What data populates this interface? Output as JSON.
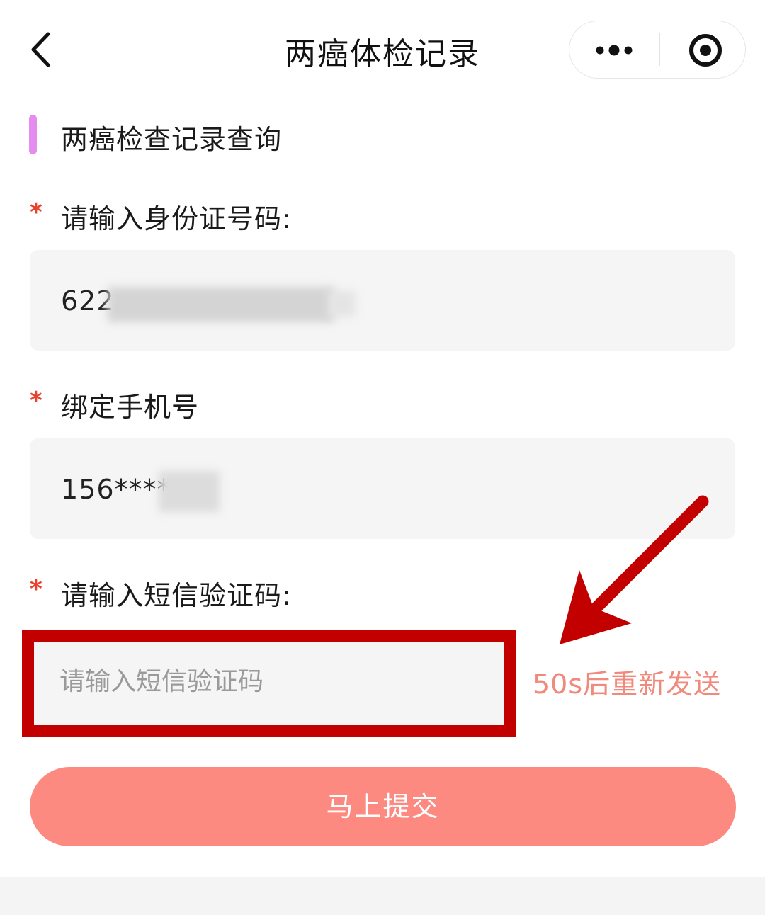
{
  "nav": {
    "title": "两癌体检记录",
    "back_icon": "chevron-left-icon",
    "more_icon": "more-dots-icon",
    "close_icon": "target-circle-icon"
  },
  "section": {
    "title": "两癌检查记录查询",
    "accent_color": "#e58cf1"
  },
  "form": {
    "id_field": {
      "required_mark": "*",
      "label": "请输入身份证号码:",
      "value": "622"
    },
    "phone_field": {
      "required_mark": "*",
      "label": "绑定手机号",
      "value": "156****"
    },
    "sms_field": {
      "required_mark": "*",
      "label": "请输入短信验证码:",
      "placeholder": "请输入短信验证码",
      "value": ""
    },
    "resend_label": "50s后重新发送",
    "submit_label": "马上提交"
  },
  "colors": {
    "required": "#e8422e",
    "resend": "#f08a7d",
    "submit_bg": "#fd8a80",
    "annotation": "#c20000"
  }
}
